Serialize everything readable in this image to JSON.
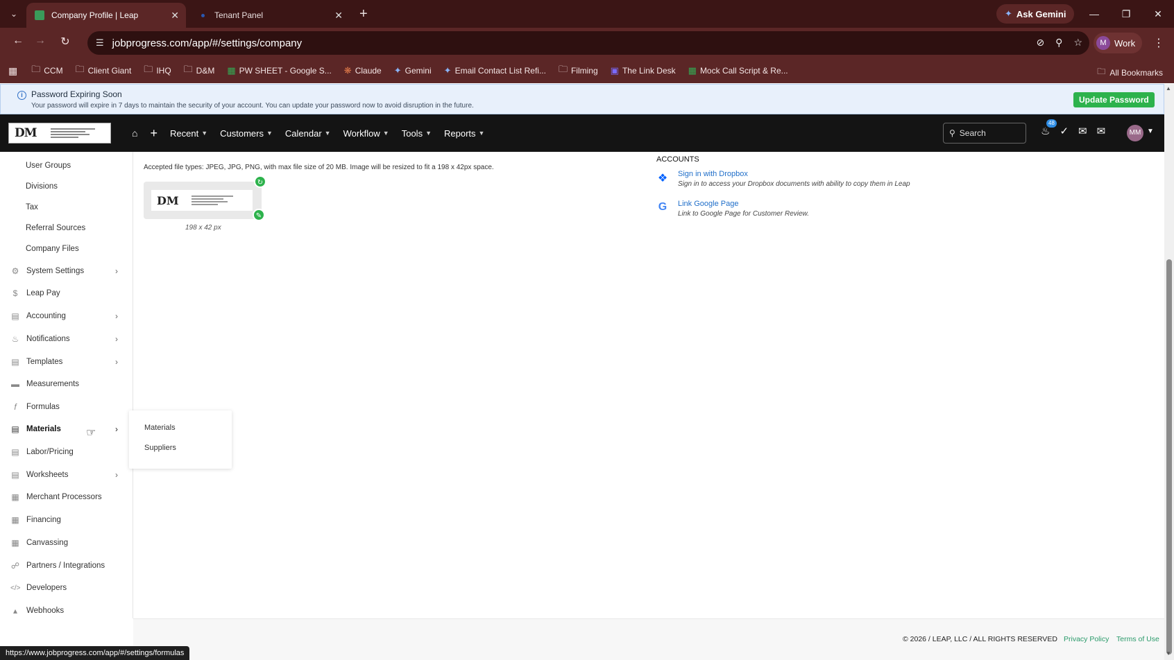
{
  "browser": {
    "tabs": [
      {
        "label": "Company Profile | Leap",
        "active": true
      },
      {
        "label": "Tenant Panel",
        "active": false
      }
    ],
    "ask_gemini": "Ask Gemini",
    "url": "jobprogress.com/app/#/settings/company",
    "profile_initial": "M",
    "profile_label": "Work",
    "bookmarks": [
      {
        "label": "CCM",
        "icon": "folder-icon"
      },
      {
        "label": "Client Giant",
        "icon": "folder-icon"
      },
      {
        "label": "IHQ",
        "icon": "folder-icon"
      },
      {
        "label": "D&M",
        "icon": "folder-icon"
      },
      {
        "label": "PW SHEET - Google S...",
        "icon": "sheets-icon"
      },
      {
        "label": "Claude",
        "icon": "claude-icon"
      },
      {
        "label": "Gemini",
        "icon": "gemini-icon"
      },
      {
        "label": "Email Contact List Refi...",
        "icon": "gemini-icon"
      },
      {
        "label": "Filming",
        "icon": "folder-icon"
      },
      {
        "label": "The Link Desk",
        "icon": "link-desk-icon"
      },
      {
        "label": "Mock Call Script & Re...",
        "icon": "sheets-icon"
      }
    ],
    "all_bookmarks": "All Bookmarks",
    "status_url": "https://www.jobprogress.com/app/#/settings/formulas"
  },
  "alert": {
    "title": "Password Expiring Soon",
    "message": "Your password will expire in 7 days to maintain the security of your account. You can update your password now to avoid disruption in the future.",
    "button": "Update Password"
  },
  "header": {
    "nav": [
      "Recent",
      "Customers",
      "Calendar",
      "Workflow",
      "Tools",
      "Reports"
    ],
    "search_placeholder": "Search",
    "notification_count": "48",
    "user_initials": "MM"
  },
  "sidebar": {
    "items": [
      {
        "label": "User Groups",
        "sub": true
      },
      {
        "label": "Divisions",
        "sub": true
      },
      {
        "label": "Tax",
        "sub": true
      },
      {
        "label": "Referral Sources",
        "sub": true
      },
      {
        "label": "Company Files",
        "sub": true
      },
      {
        "label": "System Settings",
        "icon": "gear-icon",
        "arrow": true
      },
      {
        "label": "Leap Pay",
        "icon": "dollar-icon"
      },
      {
        "label": "Accounting",
        "icon": "ledger-icon",
        "arrow": true
      },
      {
        "label": "Notifications",
        "icon": "bell-icon",
        "arrow": true
      },
      {
        "label": "Templates",
        "icon": "template-icon",
        "arrow": true
      },
      {
        "label": "Measurements",
        "icon": "measure-icon"
      },
      {
        "label": "Formulas",
        "icon": "formula-icon"
      },
      {
        "label": "Materials",
        "icon": "clipboard-icon",
        "arrow": true,
        "active": true
      },
      {
        "label": "Labor/Pricing",
        "icon": "clipboard-icon"
      },
      {
        "label": "Worksheets",
        "icon": "clipboard-icon",
        "arrow": true
      },
      {
        "label": "Merchant Processors",
        "icon": "building-icon"
      },
      {
        "label": "Financing",
        "icon": "building-icon"
      },
      {
        "label": "Canvassing",
        "icon": "building-icon"
      },
      {
        "label": "Partners / Integrations",
        "icon": "partners-icon"
      },
      {
        "label": "Developers",
        "icon": "code-icon"
      },
      {
        "label": "Webhooks",
        "icon": "webhook-icon"
      }
    ],
    "flyout": [
      "Materials",
      "Suppliers"
    ]
  },
  "main": {
    "file_types": "Accepted file types: JPEG, JPG, PNG, with max file size of 20 MB. Image will be resized to fit a 198 x 42px space.",
    "logo_text": "DM",
    "logo_dimensions": "198 x 42 px",
    "accounts_title": "ACCOUNTS",
    "accounts": [
      {
        "link": "Sign in with Dropbox",
        "desc": "Sign in to access your Dropbox documents with ability to copy them in Leap",
        "icon": "dropbox-icon"
      },
      {
        "link": "Link Google Page",
        "desc": "Link to Google Page for Customer Review.",
        "icon": "google-icon"
      }
    ]
  },
  "footer": {
    "copyright": "© 2026 / LEAP, LLC / ALL RIGHTS RESERVED",
    "privacy": "Privacy Policy",
    "terms": "Terms of Use"
  },
  "colors": {
    "browser_tabbar": "#3b1515",
    "browser_toolbar": "#5b2626",
    "app_header": "#141414",
    "accent_green": "#2db24c",
    "link_blue": "#1f6ec9"
  }
}
